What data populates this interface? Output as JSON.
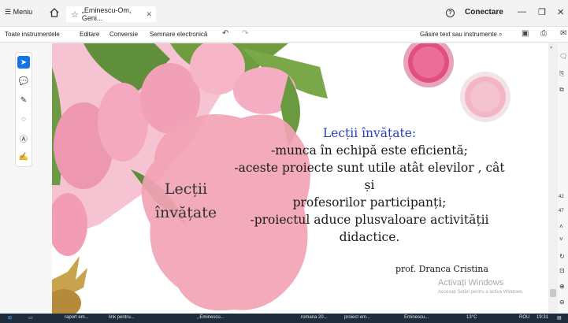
{
  "browser": {
    "menu_label": "Meniu",
    "tab_title": "„Eminescu-Om, Geni...",
    "signin_label": "Conectare"
  },
  "toolbar": {
    "items": [
      "Toate instrumentele",
      "Editare",
      "Conversie",
      "Semnare electronică"
    ],
    "find_label": "Găsire text sau instrumente"
  },
  "slide": {
    "side_title_line1": "Lecții",
    "side_title_line2": "învățate",
    "heading": "Lecții învățate:",
    "lines": [
      "-munca în echipă este eficientă;",
      "-aceste proiecte sunt utile atât elevilor , cât și",
      "profesorilor participanți;",
      "-proiectul aduce plusvaloare activității",
      "didactice."
    ],
    "author": "prof. Dranca Cristina"
  },
  "watermark": {
    "title": "Activați Windows",
    "subtitle": "Accesați Setări pentru a activa Windows."
  },
  "right_rail": {
    "page_current": "42",
    "page_total": "47"
  },
  "taskbar": {
    "items": [
      "raport em...",
      "link pentru...",
      ",,Eminescu...",
      "romana 20...",
      "proiect em...",
      "Eminescu..."
    ],
    "weather": "13°C",
    "language": "ROU",
    "clock": "19:31"
  },
  "colors": {
    "heading_blue": "#2a3fbf",
    "accent_blue": "#1473e6",
    "pink_blob": "#f2a3b4"
  }
}
